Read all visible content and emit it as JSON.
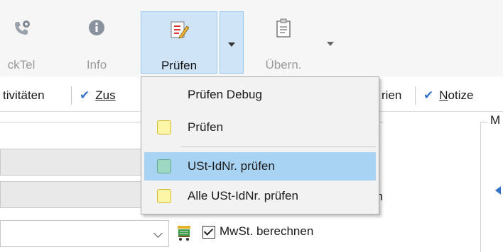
{
  "ribbon": {
    "quicktel_label": "ckTel",
    "info_label": "Info",
    "pruefen_label": "Prüfen",
    "uebern_label": "Übern."
  },
  "tabs": {
    "aktivitaeten": "tivitäten",
    "zus": "Zus",
    "serien": "rien",
    "notize_n": "N",
    "notize_rest": "otize"
  },
  "form": {
    "mwst_label": "MwSt. berechnen",
    "partial_en": "en",
    "right_partial": "M"
  },
  "menu": {
    "items": [
      {
        "label": "Prüfen Debug",
        "swatch": null
      },
      {
        "label": "Prüfen",
        "swatch": "yellow"
      },
      {
        "label": "USt-IdNr. prüfen",
        "swatch": "green",
        "highlighted": true
      },
      {
        "label": "Alle USt-IdNr. prüfen",
        "swatch": "yellow"
      }
    ]
  },
  "colors": {
    "accent_highlight": "#a9d3f2",
    "button_pressed": "#cfe4f6",
    "check_blue": "#3672c7",
    "swatch_yellow": "#fdf6a7",
    "swatch_green": "#9ed7c2"
  },
  "icons": [
    "phone-settings-icon",
    "info-icon",
    "checklist-pencil-icon",
    "clipboard-icon",
    "shopping-cart-icon",
    "checkmark-icon"
  ]
}
